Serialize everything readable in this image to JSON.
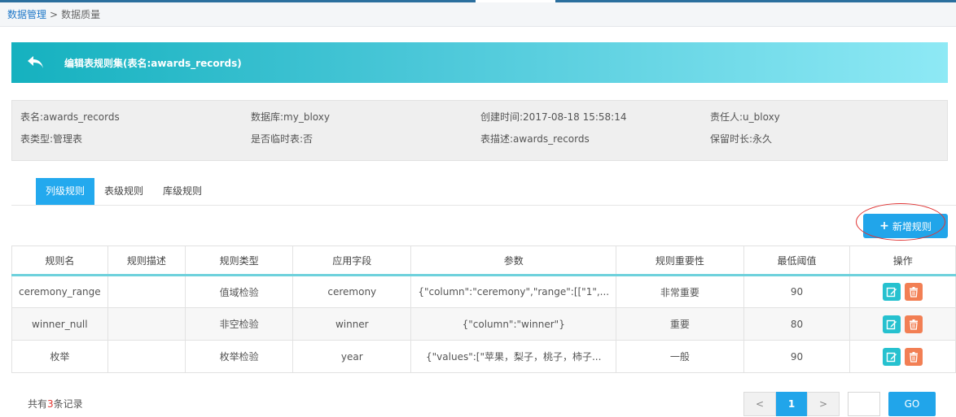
{
  "breadcrumb": {
    "parent": "数据管理",
    "separator": ">",
    "current": "数据质量"
  },
  "banner": {
    "title": "编辑表规则集(表名:awards_records)",
    "back_icon": "back-arrow-icon"
  },
  "info": {
    "table_name": "表名:awards_records",
    "database": "数据库:my_bloxy",
    "created_time": "创建时间:2017-08-18 15:58:14",
    "owner": "责任人:u_bloxy",
    "table_type": "表类型:管理表",
    "is_temp": "是否临时表:否",
    "description": "表描述:awards_records",
    "retention": "保留时长:永久"
  },
  "tabs": [
    {
      "label": "列级规则",
      "active": true
    },
    {
      "label": "表级规则",
      "active": false
    },
    {
      "label": "库级规则",
      "active": false
    }
  ],
  "add_rule_button": "新增规则",
  "table": {
    "headers": [
      "规则名",
      "规则描述",
      "规则类型",
      "应用字段",
      "参数",
      "规则重要性",
      "最低阈值",
      "操作"
    ],
    "rows": [
      {
        "name": "ceremony_range",
        "desc": "",
        "type": "值域检验",
        "field": "ceremony",
        "params": "{\"column\":\"ceremony\",\"range\":[[\"1\",...",
        "importance": "非常重要",
        "threshold": "90"
      },
      {
        "name": "winner_null",
        "desc": "",
        "type": "非空检验",
        "field": "winner",
        "params": "{\"column\":\"winner\"}",
        "importance": "重要",
        "threshold": "80"
      },
      {
        "name": "枚举",
        "desc": "",
        "type": "枚举检验",
        "field": "year",
        "params": "{\"values\":[\"苹果，梨子，桃子，柿子...",
        "importance": "一般",
        "threshold": "90"
      }
    ]
  },
  "footer": {
    "total_prefix": "共有",
    "total_count": "3",
    "total_suffix": "条记录"
  },
  "pagination": {
    "prev": "<",
    "current": "1",
    "next": ">",
    "go": "GO",
    "input_value": ""
  },
  "colors": {
    "accent": "#21a5ea",
    "edit": "#26c1cf",
    "delete": "#f27f54",
    "banner_start": "#15b1bf",
    "banner_end": "#8ee9f5"
  }
}
